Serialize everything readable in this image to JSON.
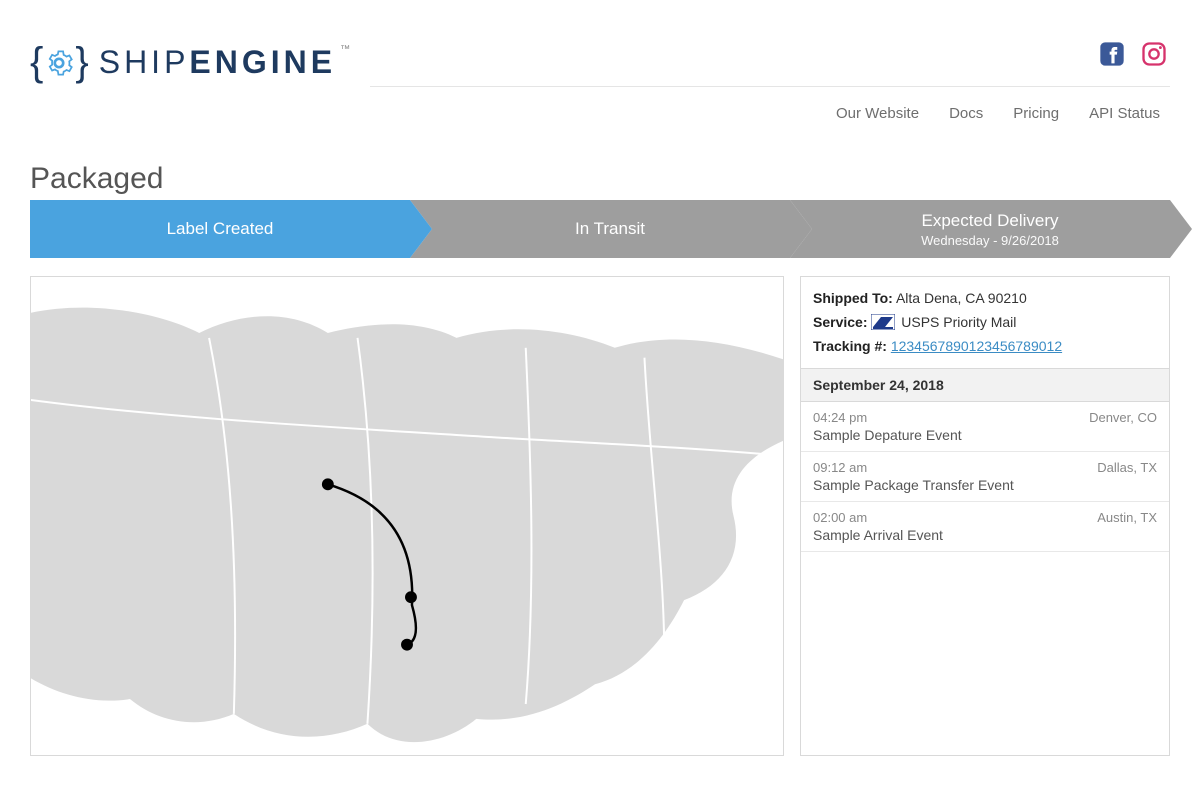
{
  "brand": {
    "name_light": "SHIP",
    "name_bold": "ENGINE",
    "tm": "™"
  },
  "social": {
    "facebook": "facebook",
    "instagram": "instagram"
  },
  "nav": {
    "items": [
      "Our Website",
      "Docs",
      "Pricing",
      "API Status"
    ]
  },
  "page": {
    "title": "Packaged"
  },
  "progress": {
    "steps": [
      {
        "label": "Label Created",
        "active": true
      },
      {
        "label": "In Transit",
        "active": false
      },
      {
        "label": "Expected Delivery",
        "sub": "Wednesday - 9/26/2018",
        "active": false
      }
    ]
  },
  "details": {
    "shipped_to_label": "Shipped To:",
    "shipped_to_value": "Alta Dena, CA 90210",
    "service_label": "Service:",
    "service_value": "USPS Priority Mail",
    "tracking_label": "Tracking #:",
    "tracking_value": "1234567890123456789012",
    "date_header": "September 24, 2018",
    "events": [
      {
        "time": "04:24 pm",
        "loc": "Denver, CO",
        "desc": "Sample Depature Event"
      },
      {
        "time": "09:12 am",
        "loc": "Dallas, TX",
        "desc": "Sample Package Transfer Event"
      },
      {
        "time": "02:00 am",
        "loc": "Austin, TX",
        "desc": "Sample Arrival Event"
      }
    ]
  }
}
